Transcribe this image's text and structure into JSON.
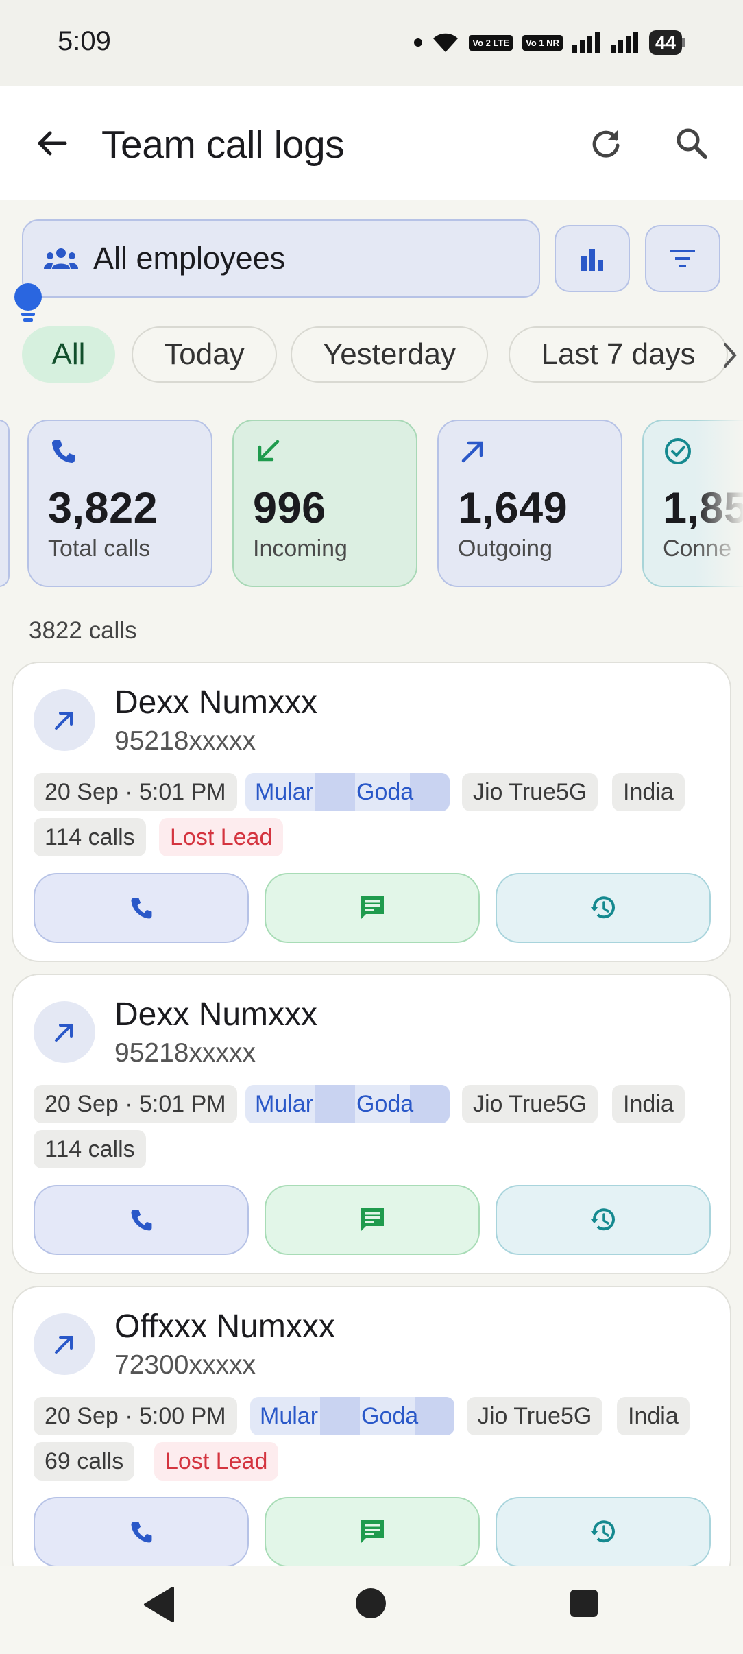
{
  "status_bar": {
    "time": "5:09",
    "sim1": "Vo 2 LTE",
    "sim2": "Vo 1 NR",
    "battery": "44",
    "icons": [
      "dot-icon",
      "wifi-icon",
      "signal-icon",
      "signal-icon",
      "battery-icon"
    ]
  },
  "header": {
    "title": "Team call logs",
    "icons": [
      "back-arrow-icon",
      "refresh-icon",
      "search-icon"
    ]
  },
  "employee_filter": {
    "label": "All employees",
    "icon": "people-icon"
  },
  "toolbar_icons": [
    "bar-chart-icon",
    "filter-icon"
  ],
  "date_chips": {
    "items": [
      "All",
      "Today",
      "Yesterday",
      "Last 7 days"
    ],
    "selected": "All"
  },
  "stats": [
    {
      "value": "3,822",
      "label": "Total calls",
      "icon": "phone-icon"
    },
    {
      "value": "996",
      "label": "Incoming",
      "icon": "incoming-arrow-icon"
    },
    {
      "value": "1,649",
      "label": "Outgoing",
      "icon": "outgoing-arrow-icon"
    },
    {
      "value": "1,85",
      "label": "Conne",
      "icon": "check-circle-icon"
    }
  ],
  "calls_summary": "3822 calls",
  "calls": [
    {
      "name": "Dexx Numxxx",
      "number": "95218xxxxx",
      "datetime": "20 Sep · 5:01 PM",
      "employee_a": "Mular",
      "employee_b": "Goda",
      "carrier": "Jio True5G",
      "country": "India",
      "call_count": "114 calls",
      "status": "Lost Lead"
    },
    {
      "name": "Dexx Numxxx",
      "number": "95218xxxxx",
      "datetime": "20 Sep · 5:01 PM",
      "employee_a": "Mular",
      "employee_b": "Goda",
      "carrier": "Jio True5G",
      "country": "India",
      "call_count": "114 calls",
      "status": ""
    },
    {
      "name": "Offxxx Numxxx",
      "number": "72300xxxxx",
      "datetime": "20 Sep · 5:00 PM",
      "employee_a": "Mular",
      "employee_b": "Goda",
      "carrier": "Jio True5G",
      "country": "India",
      "call_count": "69 calls",
      "status": "Lost Lead"
    }
  ],
  "colors": {
    "accent_blue": "#2a58c8",
    "incoming_green": "#1f9b4d",
    "outgoing_blue": "#2a58c8",
    "connected_teal": "#15898f",
    "lost_lead_red": "#d4343f"
  }
}
